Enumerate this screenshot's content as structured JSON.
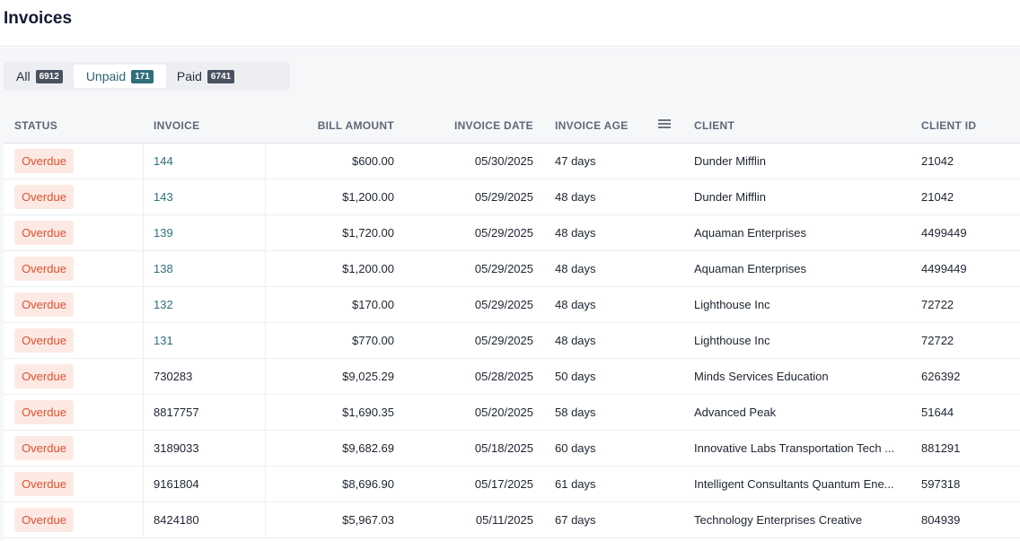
{
  "page": {
    "title": "Invoices"
  },
  "tabs": [
    {
      "label": "All",
      "count": "6912"
    },
    {
      "label": "Unpaid",
      "count": "171"
    },
    {
      "label": "Paid",
      "count": "6741"
    }
  ],
  "table": {
    "columns": {
      "status": "STATUS",
      "invoice": "INVOICE",
      "bill_amount": "BILL AMOUNT",
      "invoice_date": "INVOICE DATE",
      "invoice_age": "INVOICE AGE",
      "client": "CLIENT",
      "client_id": "CLIENT ID"
    },
    "rows": [
      {
        "status": "Overdue",
        "invoice": "144",
        "bill_amount": "$600.00",
        "invoice_date": "05/30/2025",
        "invoice_age": "47 days",
        "client": "Dunder Mifflin",
        "client_id": "21042"
      },
      {
        "status": "Overdue",
        "invoice": "143",
        "bill_amount": "$1,200.00",
        "invoice_date": "05/29/2025",
        "invoice_age": "48 days",
        "client": "Dunder Mifflin",
        "client_id": "21042"
      },
      {
        "status": "Overdue",
        "invoice": "139",
        "bill_amount": "$1,720.00",
        "invoice_date": "05/29/2025",
        "invoice_age": "48 days",
        "client": "Aquaman Enterprises",
        "client_id": "4499449"
      },
      {
        "status": "Overdue",
        "invoice": "138",
        "bill_amount": "$1,200.00",
        "invoice_date": "05/29/2025",
        "invoice_age": "48 days",
        "client": "Aquaman Enterprises",
        "client_id": "4499449"
      },
      {
        "status": "Overdue",
        "invoice": "132",
        "bill_amount": "$170.00",
        "invoice_date": "05/29/2025",
        "invoice_age": "48 days",
        "client": "Lighthouse Inc",
        "client_id": "72722"
      },
      {
        "status": "Overdue",
        "invoice": "131",
        "bill_amount": "$770.00",
        "invoice_date": "05/29/2025",
        "invoice_age": "48 days",
        "client": "Lighthouse Inc",
        "client_id": "72722"
      },
      {
        "status": "Overdue",
        "invoice": "730283",
        "bill_amount": "$9,025.29",
        "invoice_date": "05/28/2025",
        "invoice_age": "50 days",
        "client": "Minds Services Education",
        "client_id": "626392"
      },
      {
        "status": "Overdue",
        "invoice": "8817757",
        "bill_amount": "$1,690.35",
        "invoice_date": "05/20/2025",
        "invoice_age": "58 days",
        "client": "Advanced Peak",
        "client_id": "51644"
      },
      {
        "status": "Overdue",
        "invoice": "3189033",
        "bill_amount": "$9,682.69",
        "invoice_date": "05/18/2025",
        "invoice_age": "60 days",
        "client": "Innovative Labs Transportation Tech ...",
        "client_id": "881291"
      },
      {
        "status": "Overdue",
        "invoice": "9161804",
        "bill_amount": "$8,696.90",
        "invoice_date": "05/17/2025",
        "invoice_age": "61 days",
        "client": "Intelligent Consultants Quantum Ene...",
        "client_id": "597318"
      },
      {
        "status": "Overdue",
        "invoice": "8424180",
        "bill_amount": "$5,967.03",
        "invoice_date": "05/11/2025",
        "invoice_age": "67 days",
        "client": "Technology Enterprises Creative",
        "client_id": "804939"
      }
    ]
  },
  "colors": {
    "overdue_text": "#e0502f",
    "overdue_bg": "#fde9e3",
    "link": "#2f6f7c",
    "active_tab_badge": "#2f6f7c"
  }
}
